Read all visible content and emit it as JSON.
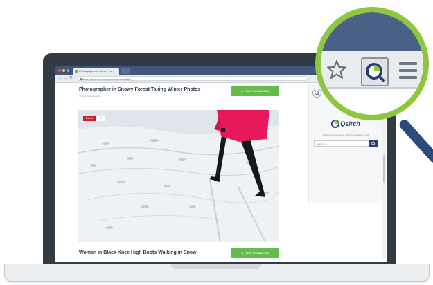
{
  "browser": {
    "tab_title": "Photographer in Snowy Fo...",
    "url": "https://pixabay.com/photos/snow-winter-..."
  },
  "content": {
    "item1_title": "Photographer in Snowy Forest Taking Winter Photos",
    "item1_meta": "4 Free Photos Available",
    "download_label": "▲ FREE DOWNLOAD",
    "pin_label": "Pin it",
    "pin_count": "0",
    "item2_title": "Woman in Black Knee High Boots Walking in Snow"
  },
  "sidebar": {
    "logo": "Qsirch",
    "tagline": "Anything you remember will bring the photo to you",
    "search_placeholder": "Search for..."
  },
  "colors": {
    "accent_green": "#8dc63f",
    "brand_navy": "#2a3f6e",
    "download_green": "#66bb4a",
    "coat_pink": "#e8195a"
  },
  "icons": [
    "star-icon",
    "qsirch-extension-icon",
    "menu-icon",
    "search-icon",
    "magnifier-icon"
  ]
}
